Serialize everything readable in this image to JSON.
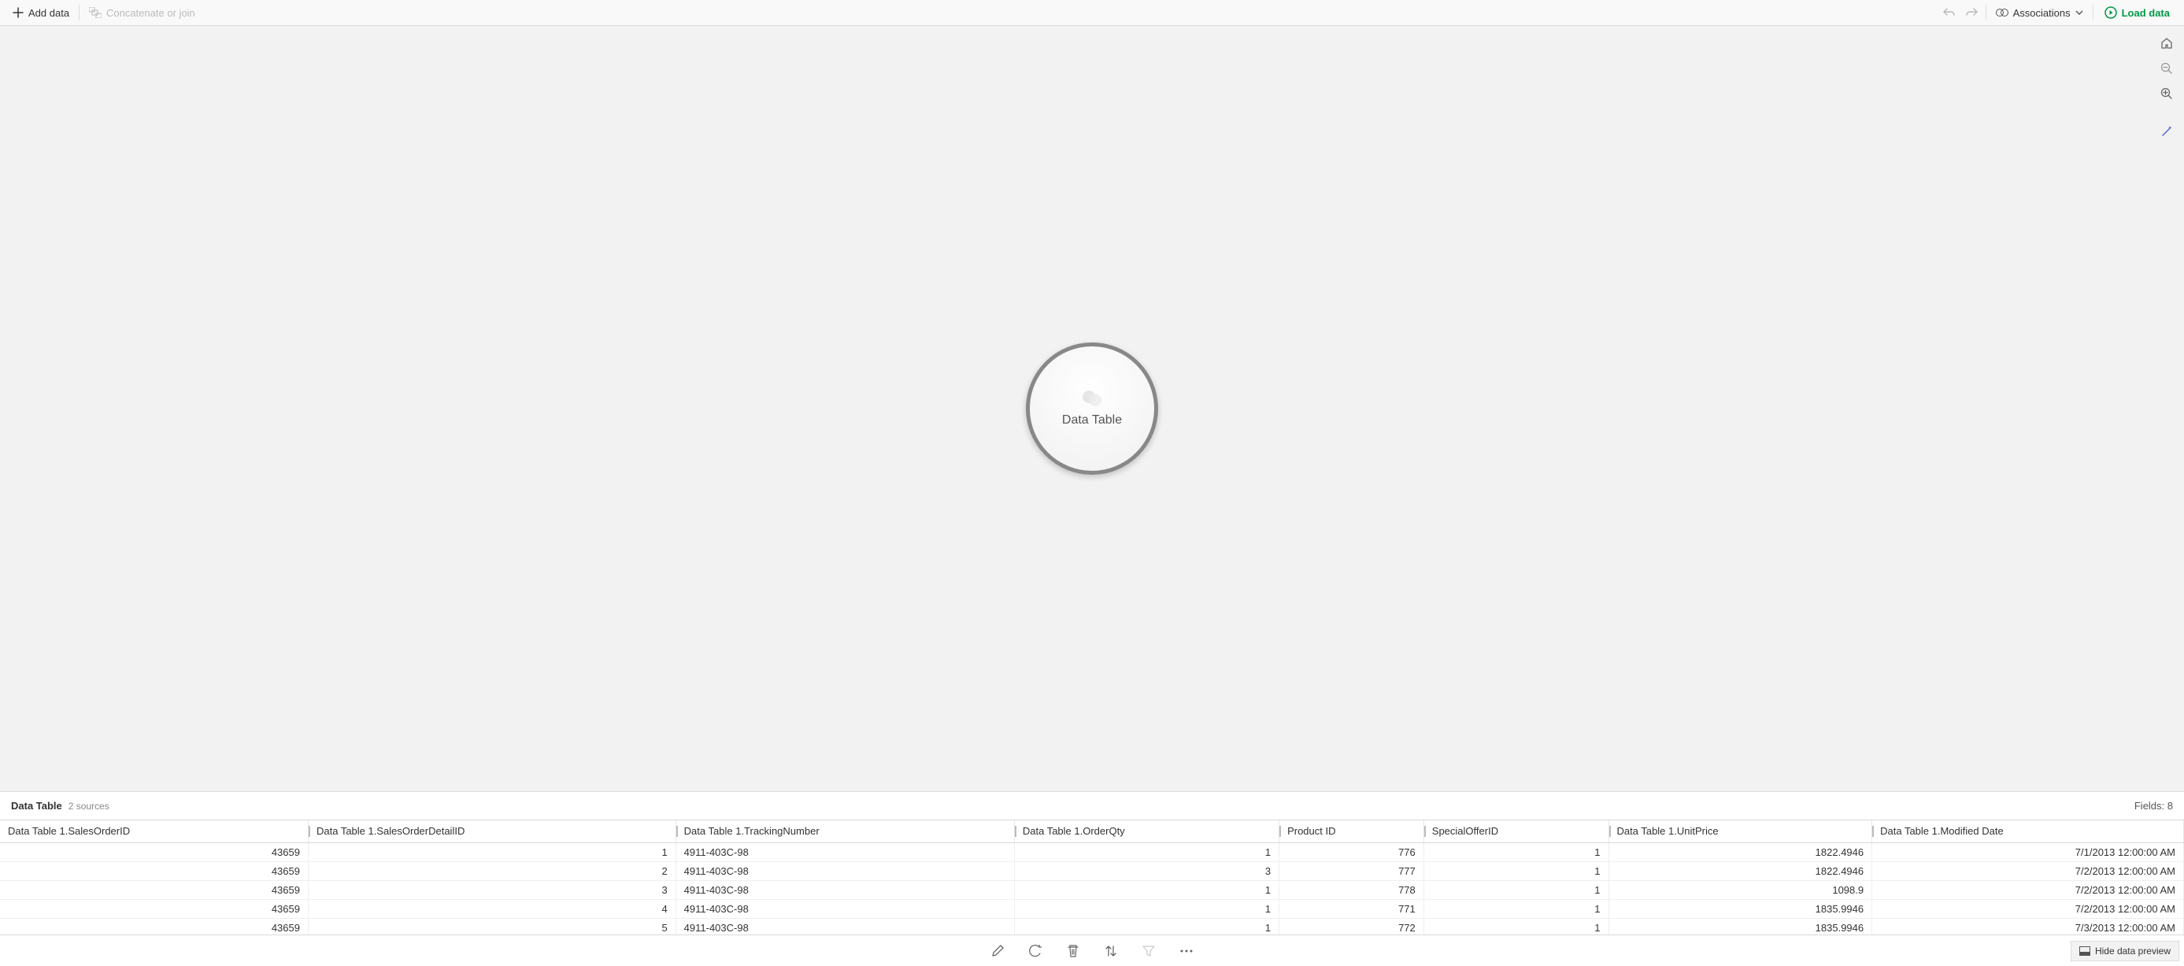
{
  "toolbar": {
    "add_data": "Add data",
    "concat_join": "Concatenate or join",
    "associations": "Associations",
    "load_data": "Load data"
  },
  "canvas": {
    "bubble_label": "Data Table"
  },
  "preview": {
    "title": "Data Table",
    "sources": "2 sources",
    "fields_label": "Fields: 8",
    "columns": [
      "Data Table 1.SalesOrderID",
      "Data Table 1.SalesOrderDetailID",
      "Data Table 1.TrackingNumber",
      "Data Table 1.OrderQty",
      "Product ID",
      "SpecialOfferID",
      "Data Table 1.UnitPrice",
      "Data Table 1.Modified Date"
    ],
    "rows": [
      {
        "c0": "43659",
        "c1": "1",
        "c2": "4911-403C-98",
        "c3": "1",
        "c4": "776",
        "c5": "1",
        "c6": "1822.4946",
        "c7": "7/1/2013 12:00:00 AM"
      },
      {
        "c0": "43659",
        "c1": "2",
        "c2": "4911-403C-98",
        "c3": "3",
        "c4": "777",
        "c5": "1",
        "c6": "1822.4946",
        "c7": "7/2/2013 12:00:00 AM"
      },
      {
        "c0": "43659",
        "c1": "3",
        "c2": "4911-403C-98",
        "c3": "1",
        "c4": "778",
        "c5": "1",
        "c6": "1098.9",
        "c7": "7/2/2013 12:00:00 AM"
      },
      {
        "c0": "43659",
        "c1": "4",
        "c2": "4911-403C-98",
        "c3": "1",
        "c4": "771",
        "c5": "1",
        "c6": "1835.9946",
        "c7": "7/2/2013 12:00:00 AM"
      },
      {
        "c0": "43659",
        "c1": "5",
        "c2": "4911-403C-98",
        "c3": "1",
        "c4": "772",
        "c5": "1",
        "c6": "1835.9946",
        "c7": "7/3/2013 12:00:00 AM"
      }
    ]
  },
  "bottom": {
    "hide_preview": "Hide data preview"
  }
}
